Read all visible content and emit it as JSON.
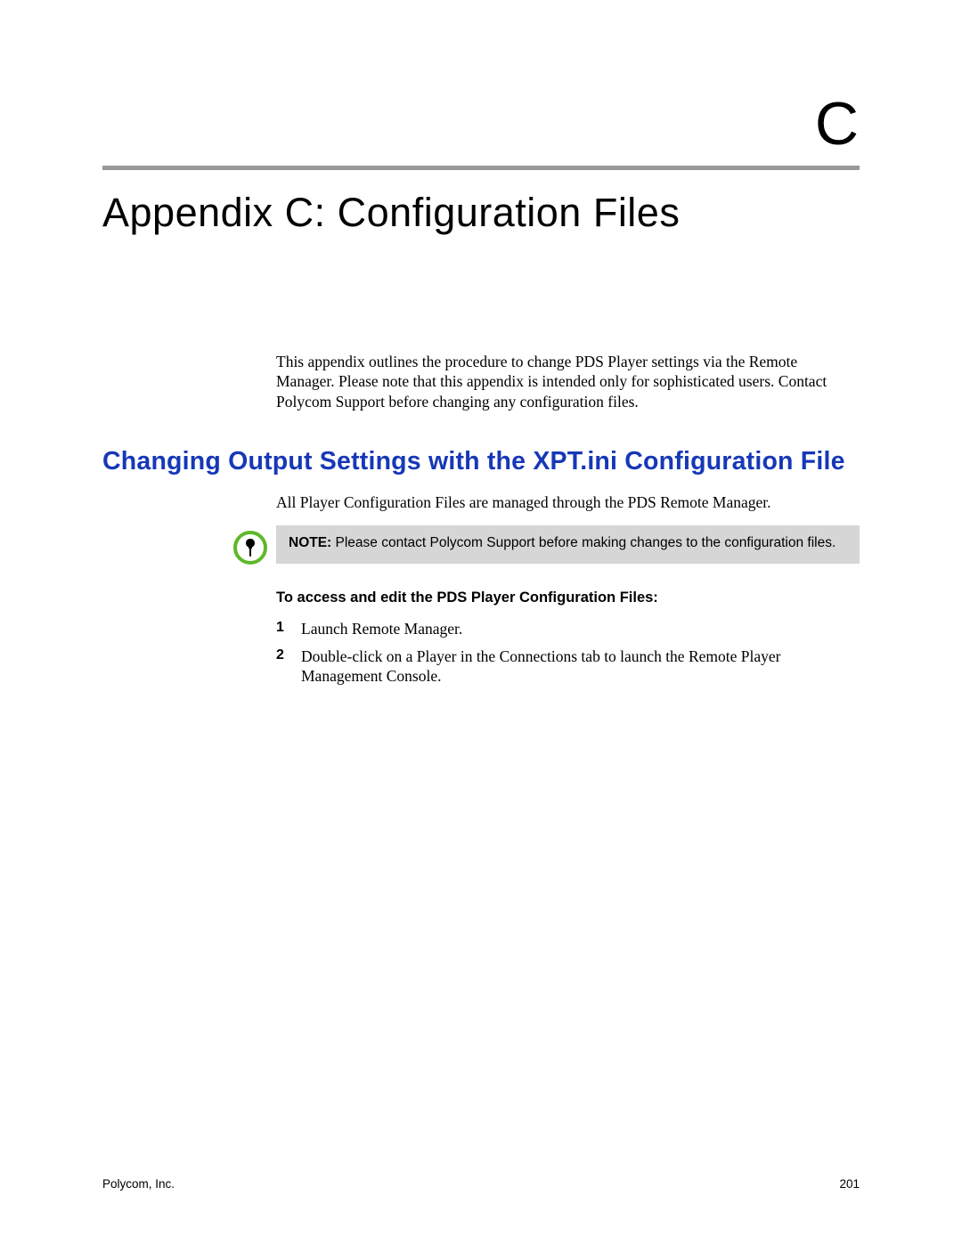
{
  "header": {
    "letter": "C",
    "title": "Appendix C: Configuration Files"
  },
  "intro": "This appendix outlines the procedure to change PDS Player settings via the Remote Manager. Please note that this appendix is intended only for sophisticated users. Contact Polycom Support before changing any configuration files.",
  "section": {
    "heading": "Changing Output Settings with the XPT.ini Configuration File",
    "para": "All Player Configuration Files are managed through the PDS Remote Manager.",
    "note_label": "NOTE:",
    "note_text": " Please contact Polycom Support before making changes to the configuration files.",
    "procedure_title": "To access and edit the PDS Player Configuration Files:",
    "steps": [
      "Launch Remote Manager.",
      "Double-click on a Player in the Connections tab to launch the Remote Player Management Console."
    ]
  },
  "footer": {
    "left": "Polycom, Inc.",
    "right": "201"
  }
}
